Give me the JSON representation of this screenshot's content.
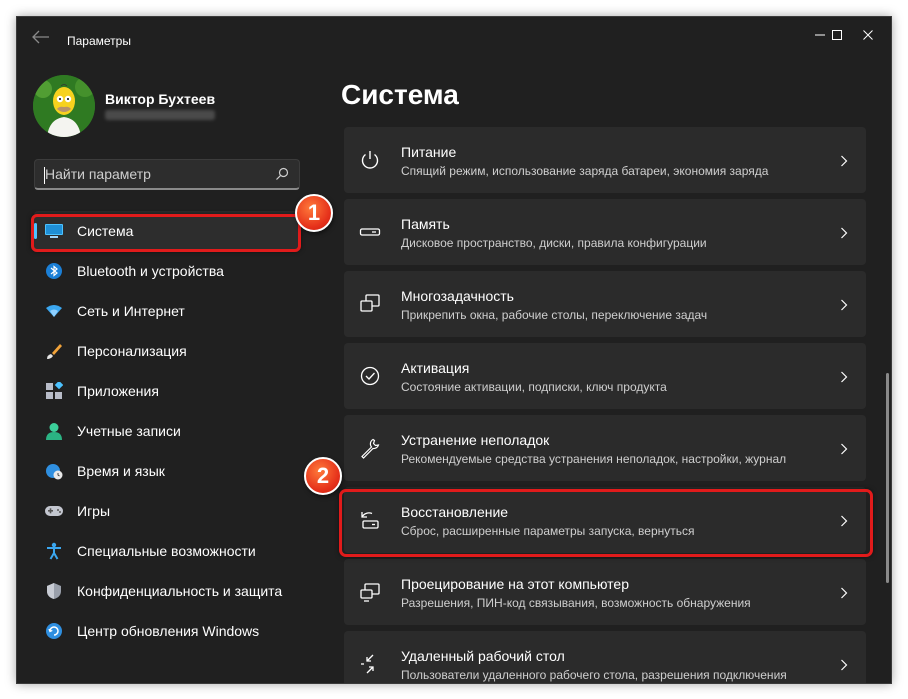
{
  "app": {
    "title": "Параметры"
  },
  "user": {
    "name": "Виктор Бухтеев"
  },
  "search": {
    "placeholder": "Найти параметр"
  },
  "nav": {
    "items": [
      {
        "label": "Система",
        "icon": "system-display-icon",
        "active": true
      },
      {
        "label": "Bluetooth и устройства",
        "icon": "bluetooth-icon"
      },
      {
        "label": "Сеть и Интернет",
        "icon": "wifi-icon"
      },
      {
        "label": "Персонализация",
        "icon": "brush-icon"
      },
      {
        "label": "Приложения",
        "icon": "apps-icon"
      },
      {
        "label": "Учетные записи",
        "icon": "account-icon"
      },
      {
        "label": "Время и язык",
        "icon": "globe-clock-icon"
      },
      {
        "label": "Игры",
        "icon": "gamepad-icon"
      },
      {
        "label": "Специальные возможности",
        "icon": "accessibility-icon"
      },
      {
        "label": "Конфиденциальность и защита",
        "icon": "shield-icon"
      },
      {
        "label": "Центр обновления Windows",
        "icon": "update-icon"
      }
    ]
  },
  "main": {
    "title": "Система",
    "cards": [
      {
        "title": "Питание",
        "desc": "Спящий режим, использование заряда батареи, экономия заряда",
        "icon": "power-icon"
      },
      {
        "title": "Память",
        "desc": "Дисковое пространство, диски, правила конфигурации",
        "icon": "storage-icon"
      },
      {
        "title": "Многозадачность",
        "desc": "Прикрепить окна, рабочие столы, переключение задач",
        "icon": "multitasking-icon"
      },
      {
        "title": "Активация",
        "desc": "Состояние активации, подписки, ключ продукта",
        "icon": "activation-icon"
      },
      {
        "title": "Устранение неполадок",
        "desc": "Рекомендуемые средства устранения неполадок, настройки, журнал",
        "icon": "wrench-icon"
      },
      {
        "title": "Восстановление",
        "desc": "Сброс, расширенные параметры запуска, вернуться",
        "icon": "recovery-icon"
      },
      {
        "title": "Проецирование на этот компьютер",
        "desc": "Разрешения, ПИН-код связывания, возможность обнаружения",
        "icon": "projection-icon"
      },
      {
        "title": "Удаленный рабочий стол",
        "desc": "Пользователи удаленного рабочего стола, разрешения подключения",
        "icon": "remote-desktop-icon"
      }
    ]
  },
  "annotations": {
    "badge1": "1",
    "badge2": "2"
  },
  "colors": {
    "accent": "#4cc2ff",
    "highlight": "#e11b1b",
    "window_bg": "#202020",
    "card_bg": "#2b2b2b"
  }
}
